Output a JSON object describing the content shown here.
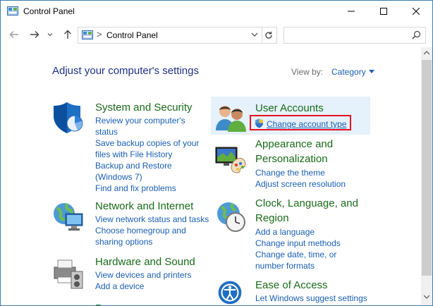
{
  "window": {
    "title": "Control Panel",
    "icon": "control-panel-icon"
  },
  "address_bar": {
    "path": "Control Panel",
    "separator": ">",
    "search_placeholder": ""
  },
  "content": {
    "heading": "Adjust your computer's settings",
    "view_by_label": "View by:",
    "view_by_value": "Category"
  },
  "categories": [
    {
      "title": "System and Security",
      "icon": "shield-icon",
      "links": [
        "Review your computer's",
        "status",
        "Save backup copies of your",
        "files with File History",
        "Backup and Restore",
        "(Windows 7)",
        "Find and fix problems"
      ]
    },
    {
      "title": "Network and Internet",
      "icon": "globe-network-icon",
      "links": [
        "View network status and tasks",
        "Choose homegroup and",
        "sharing options"
      ]
    },
    {
      "title": "Hardware and Sound",
      "icon": "printer-icon",
      "links": [
        "View devices and printers",
        "Add a device"
      ]
    },
    {
      "title": "User Accounts",
      "icon": "users-icon",
      "links": [
        "Change account type"
      ]
    },
    {
      "title": "Appearance and",
      "title2": "Personalization",
      "icon": "monitor-palette-icon",
      "links": [
        "Change the theme",
        "Adjust screen resolution"
      ]
    },
    {
      "title": "Clock, Language, and",
      "title2": "Region",
      "icon": "clock-globe-icon",
      "links": [
        "Add a language",
        "Change input methods",
        "Change date, time, or",
        "number formats"
      ]
    },
    {
      "title": "Ease of Access",
      "icon": "ease-of-access-icon",
      "links": [
        "Let Windows suggest settings"
      ]
    },
    {
      "title": "P",
      "icon": "programs-icon",
      "links": []
    }
  ],
  "colors": {
    "category_title": "#1a6b1a",
    "link": "#1a5fb4",
    "heading": "#1e3287",
    "highlight_bg": "#e5f1fb",
    "annotation_box": "#e81123"
  }
}
